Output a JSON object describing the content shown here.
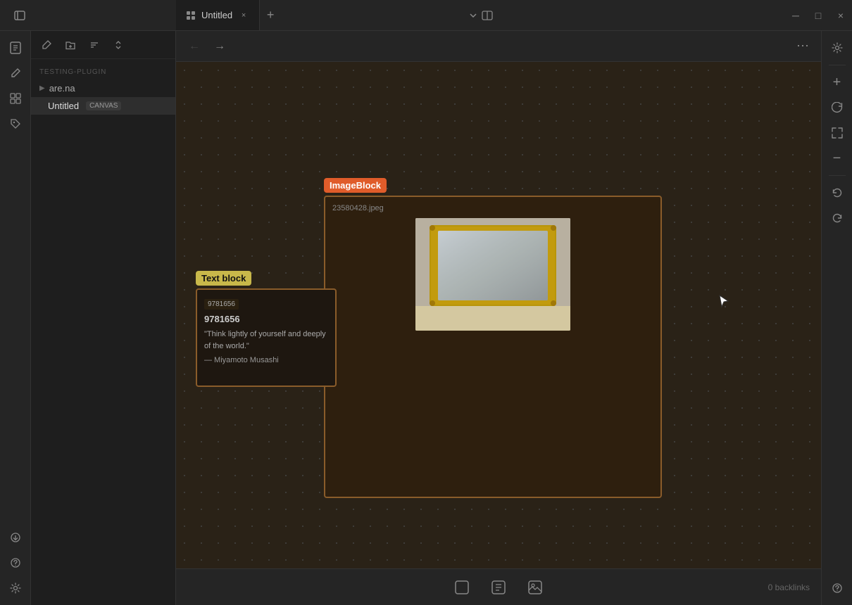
{
  "titlebar": {
    "tab_label": "Untitled",
    "tab_icon": "grid-icon",
    "add_tab_label": "+",
    "close_label": "×",
    "dropdown_icon": "chevron-down-icon",
    "layout_icon": "layout-icon",
    "minimize_label": "─",
    "maximize_label": "□",
    "close_window_label": "×"
  },
  "sidebar": {
    "toggle_icon": "sidebar-toggle-icon",
    "folder_icon": "folder-icon",
    "search_icon": "search-icon",
    "bookmark_icon": "bookmark-icon",
    "panel_tools": [
      "edit-icon",
      "folder-plus-icon",
      "sort-icon",
      "chevron-up-down-icon"
    ],
    "plugin_label": "TESTING-PLUGIN",
    "tree_items": [
      {
        "label": "are.na",
        "has_children": true,
        "indent": 0
      },
      {
        "label": "Untitled",
        "badge": "CANVAS",
        "active": true,
        "indent": 1
      }
    ]
  },
  "left_sidebar_icons": [
    "new-page-icon",
    "pen-icon",
    "grid-icon",
    "tag-icon",
    "pin-icon"
  ],
  "left_sidebar_bottom_icons": [
    "import-icon",
    "help-icon",
    "settings-icon"
  ],
  "canvas_toolbar": {
    "back_label": "←",
    "forward_label": "→",
    "more_label": "⋯"
  },
  "image_block": {
    "label": "ImageBlock",
    "filename": "23580428.jpeg",
    "block_id": "23580428"
  },
  "text_block": {
    "label": "Text block",
    "id_badge": "9781656",
    "id": "9781656",
    "quote": "\"Think lightly of yourself and deeply of the world.\"",
    "author": "— Miyamoto Musashi"
  },
  "right_toolbar": {
    "settings_icon": "settings-icon",
    "zoom_in_label": "+",
    "refresh_icon": "refresh-icon",
    "fullscreen_icon": "fullscreen-icon",
    "zoom_out_label": "−",
    "undo_icon": "undo-icon",
    "redo_icon": "redo-icon",
    "help_icon": "help-icon"
  },
  "bottom_bar": {
    "new_block_icon": "new-block-icon",
    "new_text_icon": "new-text-icon",
    "new_image_icon": "new-image-icon",
    "backlinks_label": "0 backlinks"
  },
  "colors": {
    "image_block_label_bg": "#e05c2a",
    "text_block_label_bg": "#c8b84a",
    "canvas_bg": "#2a2217",
    "border_accent": "#8a5c2a"
  }
}
